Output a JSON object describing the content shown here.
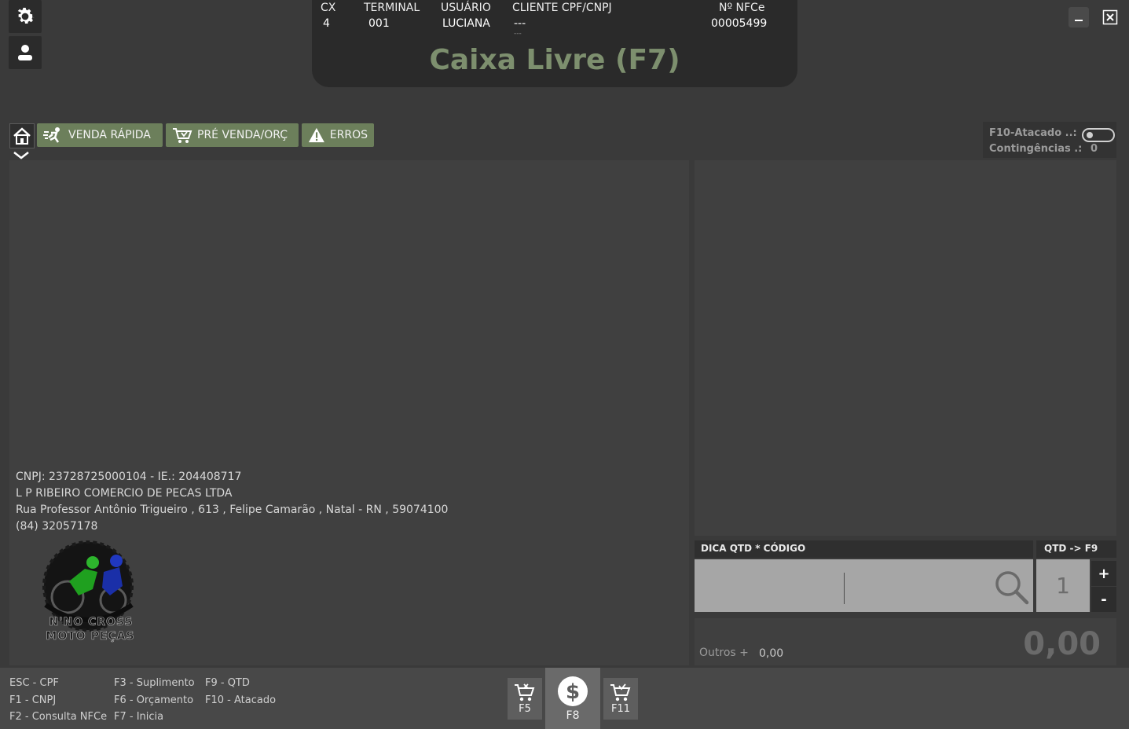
{
  "header": {
    "cx_label": "CX",
    "cx_value": "4",
    "terminal_label": "TERMINAL",
    "terminal_value": "001",
    "user_label": "USUÁRIO",
    "user_value": "LUCIANA",
    "client_label": "CLIENTE CPF/CNPJ",
    "client_value": "---",
    "client_value2": "---",
    "nfce_label": "Nº  NFCe",
    "nfce_value": "00005499",
    "status": "Caixa Livre (F7)"
  },
  "toolbar": {
    "tabs": [
      {
        "label": "VENDA RÁPIDA",
        "icon": "running-person-icon"
      },
      {
        "label": "PRÉ VENDA/ORÇ",
        "icon": "cart-icon"
      },
      {
        "label": "ERROS",
        "icon": "warning-icon"
      }
    ]
  },
  "status_box": {
    "atacado_label": "F10-Atacado ..:",
    "contingencias_label": "Contingências .:",
    "contingencias_value": "0"
  },
  "company": {
    "line1": "CNPJ: 23728725000104  -  IE.: 204408717",
    "line2": "L P RIBEIRO COMERCIO DE PECAS LTDA",
    "line3": "Rua Professor Antônio Trigueiro , 613 , Felipe Camarão , Natal - RN , 59074100",
    "line4": "(84) 32057178",
    "logo_text1": "N'NO CROSS",
    "logo_text2": "MOTO PEÇAS"
  },
  "entry": {
    "hint_label": "DICA QTD * CÓDIGO",
    "qtd_label": "QTD -> F9",
    "code_value": "",
    "qtd_value": "1",
    "plus": "+",
    "minus": "-"
  },
  "totals": {
    "others_label": "Outros +",
    "others_value": "0,00",
    "total_value": "0,00"
  },
  "footer": {
    "shortcuts_col1": [
      "ESC - CPF",
      "F1 - CNPJ",
      "F2 - Consulta NFCe"
    ],
    "shortcuts_col2": [
      "F3 - Suplimento",
      "F6 - Orçamento",
      "F7 - Inicia"
    ],
    "shortcuts_col3": [
      "F9 - QTD",
      "F10 - Atacado"
    ],
    "btn_f5": "F5",
    "btn_f8": "F8",
    "btn_f11": "F11"
  },
  "colors": {
    "accent_green": "#6c7f5b",
    "status_text": "#7d8f6e",
    "background": "#3a3a3a"
  }
}
